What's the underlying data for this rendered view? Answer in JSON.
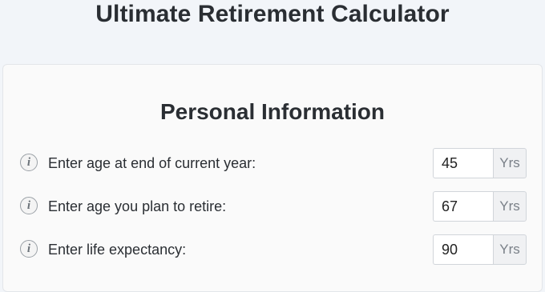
{
  "header": {
    "title": "Ultimate Retirement Calculator"
  },
  "personal_info": {
    "title": "Personal Information",
    "fields": [
      {
        "label": "Enter age at end of current year:",
        "value": "45",
        "unit": "Yrs",
        "icon": "info-icon"
      },
      {
        "label": "Enter age you plan to retire:",
        "value": "67",
        "unit": "Yrs",
        "icon": "info-icon"
      },
      {
        "label": "Enter life expectancy:",
        "value": "90",
        "unit": "Yrs",
        "icon": "info-icon"
      }
    ]
  },
  "icon_glyph": "i",
  "colors": {
    "page_background": "#f2f5f9",
    "card_background": "#fafafa",
    "title_text": "#2a2e33",
    "addon_background": "#f0f1f3"
  }
}
